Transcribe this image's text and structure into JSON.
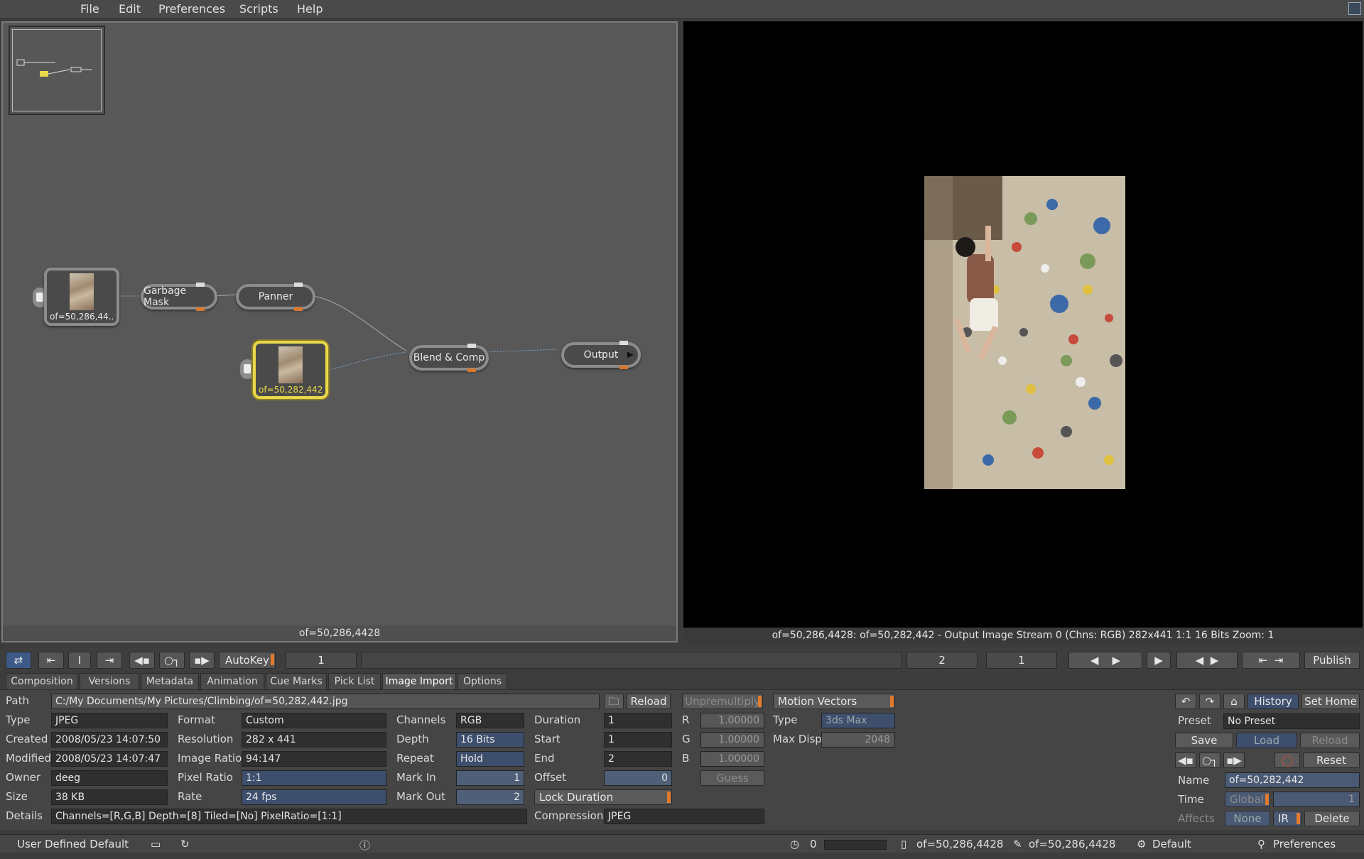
{
  "menu": {
    "file": "File",
    "edit": "Edit",
    "preferences": "Preferences",
    "scripts": "Scripts",
    "help": "Help"
  },
  "node_graph": {
    "nodes": {
      "source1": "of=50,286,44...",
      "garbage_mask": "Garbage Mask",
      "panner": "Panner",
      "source2": "of=50,282,442",
      "blend_comp": "Blend & Comp",
      "output": "Output"
    },
    "status": "of=50,286,4428"
  },
  "viewer": {
    "status": "of=50,286,4428: of=50,282,442 - Output Image  Stream 0 (Chns: RGB)  282x441  1:1  16 Bits  Zoom: 1"
  },
  "transport": {
    "autokey": "AutoKey",
    "current_frame": "1",
    "end_frame": "2",
    "step": "1",
    "publish": "Publish"
  },
  "tabs": [
    "Composition",
    "Versions",
    "Metadata",
    "Animation",
    "Cue Marks",
    "Pick List",
    "Image Import",
    "Options"
  ],
  "image_import": {
    "path_label": "Path",
    "path": "C:/My Documents/My Pictures/Climbing/of=50,282,442.jpg",
    "reload": "Reload",
    "type_label": "Type",
    "type": "JPEG",
    "created_label": "Created",
    "created": "2008/05/23 14:07:50",
    "modified_label": "Modified",
    "modified": "2008/05/23 14:07:47",
    "owner_label": "Owner",
    "owner": "deeg",
    "size_label": "Size",
    "size": "38 KB",
    "details_label": "Details",
    "details": "Channels=[R,G,B] Depth=[8] Tiled=[No] PixelRatio=[1:1]",
    "format_label": "Format",
    "format": "Custom",
    "resolution_label": "Resolution",
    "resolution": "282 x 441",
    "image_ratio_label": "Image Ratio",
    "image_ratio": "94:147",
    "pixel_ratio_label": "Pixel Ratio",
    "pixel_ratio": "1:1",
    "rate_label": "Rate",
    "rate": "24 fps",
    "channels_label": "Channels",
    "channels": "RGB",
    "depth_label": "Depth",
    "depth": "16 Bits",
    "repeat_label": "Repeat",
    "repeat": "Hold",
    "mark_in_label": "Mark In",
    "mark_in": "1",
    "mark_out_label": "Mark Out",
    "mark_out": "2",
    "duration_label": "Duration",
    "duration": "1",
    "start_label": "Start",
    "start": "1",
    "end_label": "End",
    "end": "2",
    "offset_label": "Offset",
    "offset": "0",
    "lock_duration": "Lock Duration",
    "compression_label": "Compression",
    "compression": "JPEG",
    "unpremultiply": "Unpremultiply",
    "r_label": "R",
    "r": "1.00000",
    "g_label": "G",
    "g": "1.00000",
    "b_label": "B",
    "b": "1.00000",
    "guess": "Guess",
    "motion_vectors": "Motion Vectors",
    "mv_type_label": "Type",
    "mv_type": "3ds Max",
    "max_disp_label": "Max Disp",
    "max_disp": "2048"
  },
  "right_panel": {
    "history": "History",
    "set_home": "Set Home",
    "preset_label": "Preset",
    "preset": "No Preset",
    "save": "Save",
    "load": "Load",
    "reload": "Reload",
    "reset": "Reset",
    "name_label": "Name",
    "name": "of=50,282,442",
    "time_label": "Time",
    "time_mode": "Global",
    "time_value": "1",
    "affects_label": "Affects",
    "affects": "None",
    "ir": "IR",
    "delete": "Delete"
  },
  "statusbar": {
    "layout": "User Defined Default",
    "time": "0",
    "node1": "of=50,286,4428",
    "node2": "of=50,286,4428",
    "theme": "Default",
    "preferences": "Preferences"
  },
  "colors": {
    "accent": "#e07a2a",
    "selected_node": "#e8d84a",
    "field_blue": "#3e4f6e"
  }
}
